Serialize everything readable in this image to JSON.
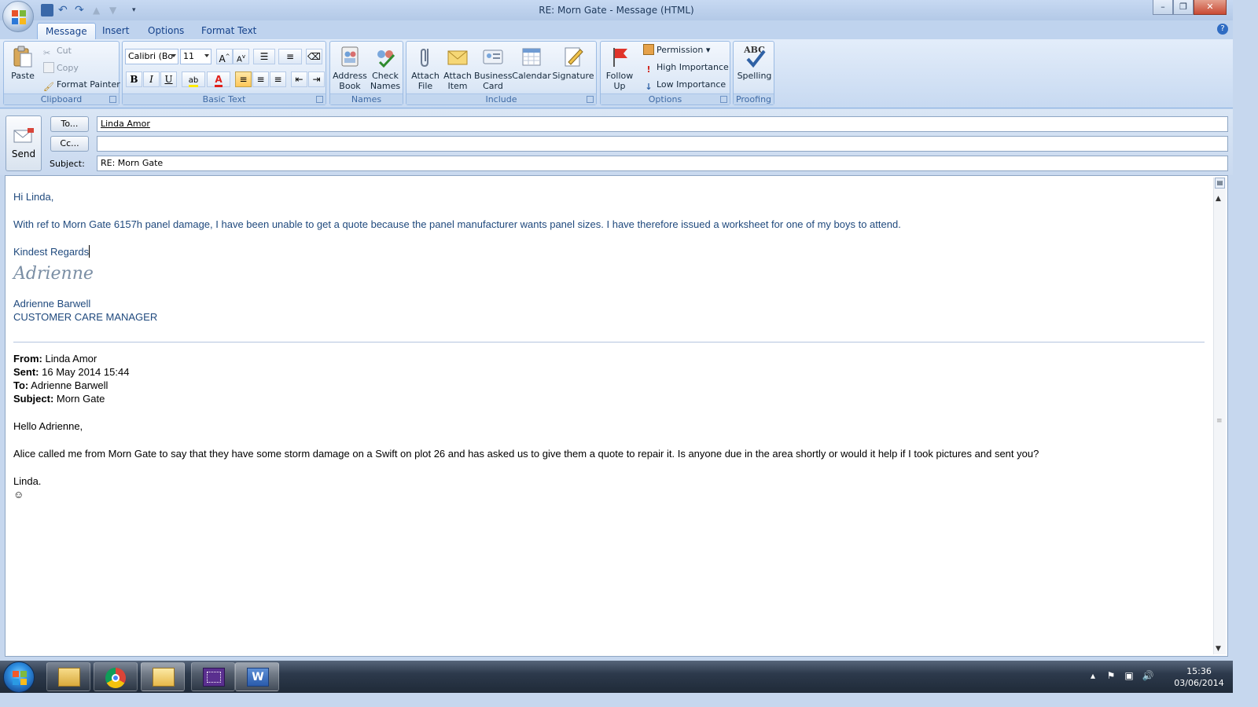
{
  "window": {
    "title": "RE: Morn Gate - Message (HTML)"
  },
  "tabs": [
    {
      "label": "Message"
    },
    {
      "label": "Insert"
    },
    {
      "label": "Options"
    },
    {
      "label": "Format Text"
    }
  ],
  "ribbon": {
    "clipboard": {
      "paste": "Paste",
      "cut": "Cut",
      "copy": "Copy",
      "format_painter": "Format Painter",
      "label": "Clipboard"
    },
    "basic_text": {
      "font": "Calibri (Bo",
      "size": "11",
      "bold": "B",
      "italic": "I",
      "underline": "U",
      "label": "Basic Text"
    },
    "names": {
      "address_book_1": "Address",
      "address_book_2": "Book",
      "check_names_1": "Check",
      "check_names_2": "Names",
      "label": "Names"
    },
    "include": {
      "attach_file_1": "Attach",
      "attach_file_2": "File",
      "attach_item_1": "Attach",
      "attach_item_2": "Item",
      "business_card_1": "Business",
      "business_card_2": "Card",
      "calendar": "Calendar",
      "signature": "Signature",
      "label": "Include"
    },
    "options": {
      "follow_up_1": "Follow",
      "follow_up_2": "Up",
      "permission": "Permission",
      "high_importance": "High Importance",
      "low_importance": "Low Importance",
      "label": "Options"
    },
    "proofing": {
      "abc": "ABC",
      "spelling": "Spelling",
      "label": "Proofing"
    }
  },
  "header": {
    "send": "Send",
    "to_button": "To...",
    "cc_button": "Cc...",
    "subject_label": "Subject:",
    "to_value": "Linda Amor",
    "cc_value": "",
    "subject_value": "RE: Morn Gate"
  },
  "message": {
    "greeting": "Hi Linda,",
    "body": "With ref to Morn Gate 6157h panel damage, I have been unable to get a quote because the panel manufacturer wants panel sizes.  I have therefore issued a worksheet for one of my boys to attend.",
    "closing": "Kindest Regards",
    "signature_script": "Adrienne",
    "sender_name": "Adrienne Barwell",
    "sender_title": "CUSTOMER CARE MANAGER"
  },
  "quoted": {
    "from_label": "From:",
    "from_value": "Linda Amor",
    "sent_label": "Sent:",
    "sent_value": "16 May 2014 15:44",
    "to_label": "To:",
    "to_value": "Adrienne Barwell",
    "subject_label": "Subject:",
    "subject_value": "Morn Gate",
    "greeting": "Hello Adrienne,",
    "body": "Alice called me from Morn Gate to say that they have some storm damage on a Swift on plot 26 and has asked us to give them a quote to repair it.  Is anyone due in the area shortly or would it help if I took pictures and sent you?",
    "signoff": "Linda.",
    "smiley": "☺"
  },
  "taskbar": {
    "time": "15:36",
    "date": "03/06/2014"
  },
  "colors": {
    "signature_blue": "#1f497d",
    "ribbon_blue": "#c7d9f1",
    "close_red": "#c94a33"
  }
}
